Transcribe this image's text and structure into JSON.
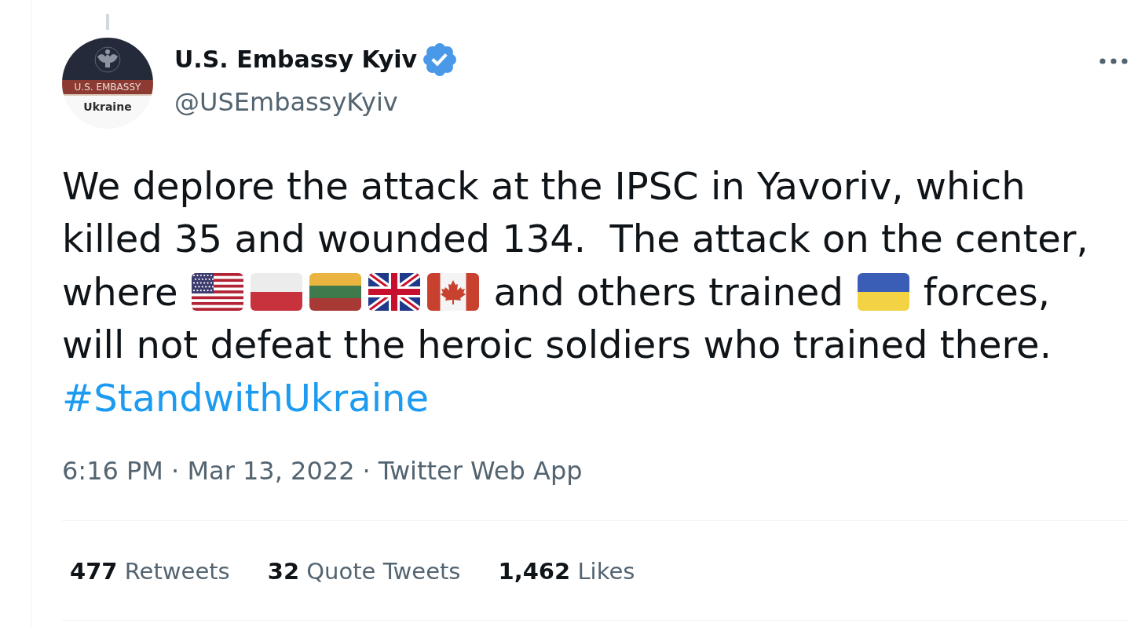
{
  "author": {
    "avatar": {
      "banner": "U.S. EMBASSY",
      "caption": "Ukraine"
    },
    "name": "U.S. Embassy Kyiv",
    "verified": true,
    "handle": "@USEmbassyKyiv"
  },
  "tweet": {
    "lines": [
      {
        "segments": [
          {
            "kind": "text",
            "text": "We deplore the attack at the IPSC in Yavoriv, which"
          }
        ]
      },
      {
        "segments": [
          {
            "kind": "text",
            "text": "killed 35 and wounded 134.  The attack on the center,"
          }
        ]
      },
      {
        "segments": [
          {
            "kind": "text",
            "text": "where"
          },
          {
            "kind": "usflag"
          },
          {
            "kind": "plflag"
          },
          {
            "kind": "ltflag"
          },
          {
            "kind": "ukflag"
          },
          {
            "kind": "caflag"
          },
          {
            "kind": "text",
            "text": "and others trained"
          },
          {
            "kind": "uaflag"
          },
          {
            "kind": "text",
            "text": "forces,"
          }
        ]
      },
      {
        "segments": [
          {
            "kind": "text",
            "text": "will not defeat the heroic soldiers who trained there."
          }
        ]
      },
      {
        "segments": [
          {
            "kind": "hashtag",
            "text": "#StandwithUkraine"
          }
        ]
      }
    ]
  },
  "meta": {
    "time": "6:16 PM · Mar 13, 2022",
    "separator": "·",
    "source": "Twitter Web App"
  },
  "stats": [
    {
      "count": "477",
      "label": "Retweets"
    },
    {
      "count": "32",
      "label": "Quote Tweets"
    },
    {
      "count": "1,462",
      "label": "Likes"
    }
  ]
}
